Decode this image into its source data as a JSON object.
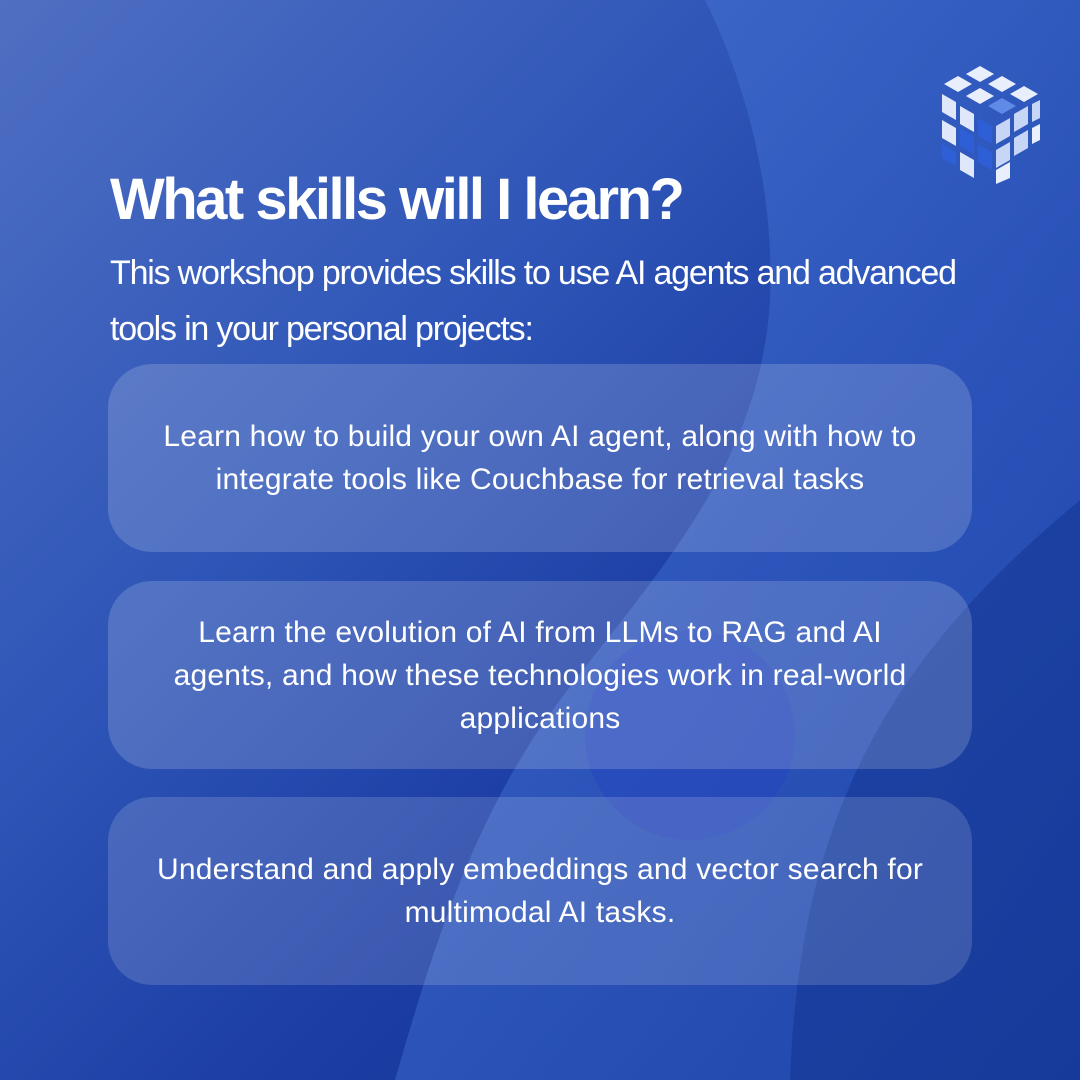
{
  "heading": "What skills will I learn?",
  "intro": "This workshop provides skills to use AI agents and advanced tools in your personal projects:",
  "skills": [
    {
      "text": "Learn how to build your own AI agent, along with how to integrate tools like Couchbase for retrieval tasks"
    },
    {
      "text": "Learn the evolution of AI from LLMs to RAG and AI agents, and how these technologies work in real-world applications"
    },
    {
      "text": "Understand and apply embeddings and vector search for multimodal AI tasks."
    }
  ],
  "logo": {
    "icon": "cube-logo-icon"
  },
  "colors": {
    "background_start": "#4f6fc2",
    "background_end": "#0d2d8c",
    "text": "#ffffff"
  }
}
